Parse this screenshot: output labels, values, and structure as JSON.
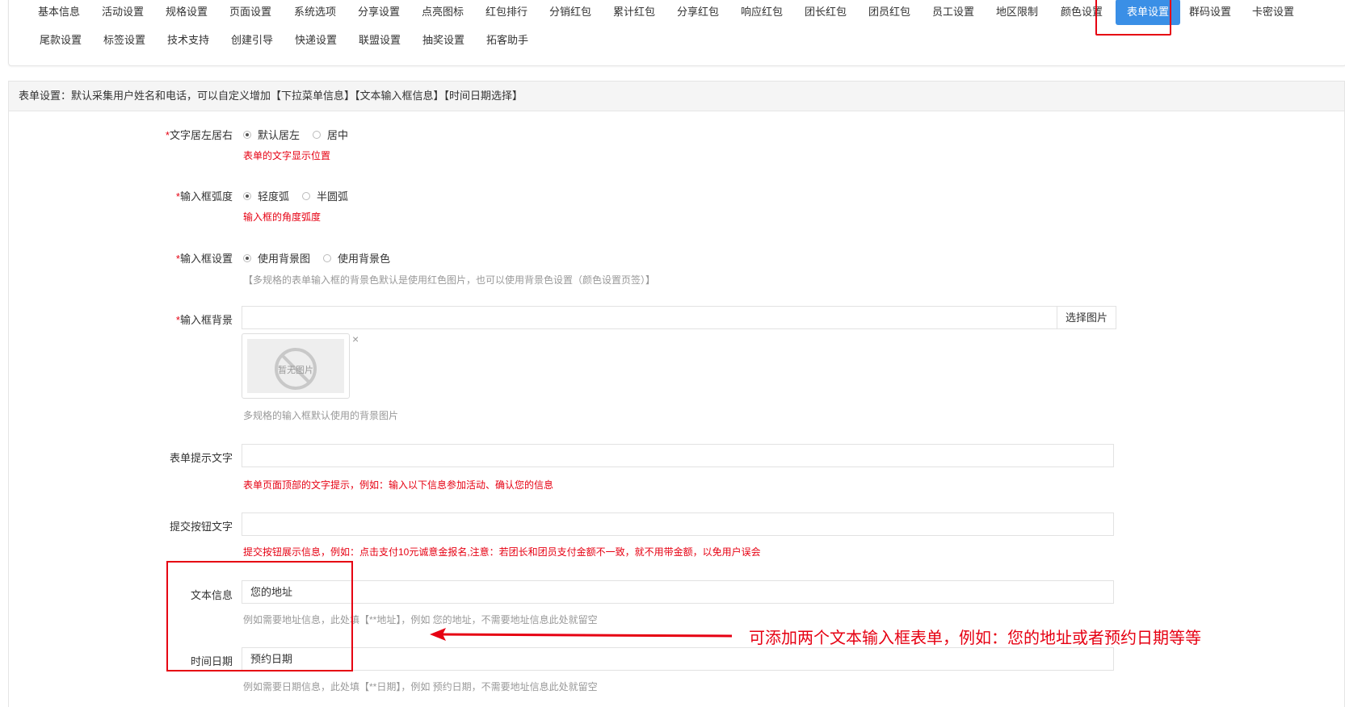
{
  "tabs_row1": [
    "基本信息",
    "活动设置",
    "规格设置",
    "页面设置",
    "系统选项",
    "分享设置",
    "点亮图标",
    "红包排行",
    "分销红包",
    "累计红包",
    "分享红包",
    "响应红包",
    "团长红包",
    "团员红包",
    "员工设置",
    "地区限制",
    "颜色设置",
    "表单设置",
    "群码设置",
    "卡密设置"
  ],
  "tabs_row2": [
    "尾款设置",
    "标签设置",
    "技术支持",
    "创建引导",
    "快递设置",
    "联盟设置",
    "抽奖设置",
    "拓客助手"
  ],
  "section_header": "表单设置：默认采集用户姓名和电话，可以自定义增加【下拉菜单信息】【文本输入框信息】【时间日期选择】",
  "required_mark": "*",
  "text_align": {
    "label": "文字居左居右",
    "options": [
      "默认居左",
      "居中"
    ],
    "hint": "表单的文字显示位置"
  },
  "input_radius": {
    "label": "输入框弧度",
    "options": [
      "轻度弧",
      "半圆弧"
    ],
    "hint": "输入框的角度弧度"
  },
  "input_setting": {
    "label": "输入框设置",
    "options": [
      "使用背景图",
      "使用背景色"
    ],
    "hint": "【多规格的表单输入框的背景色默认是使用红色图片，也可以使用背景色设置（颜色设置页签）】"
  },
  "input_bg": {
    "label": "输入框背景",
    "button": "选择图片",
    "placeholder_img_text": "暂无图片",
    "close": "×",
    "hint": "多规格的输入框默认使用的背景图片"
  },
  "form_tip": {
    "label": "表单提示文字",
    "hint": "表单页面顶部的文字提示，例如：输入以下信息参加活动、确认您的信息"
  },
  "submit_text": {
    "label": "提交按钮文字",
    "hint": "提交按钮展示信息，例如：点击支付10元诚意金报名,注意：若团长和团员支付金额不一致，就不用带金额，以免用户误会"
  },
  "text_info": {
    "label": "文本信息",
    "value": "您的地址",
    "hint": "例如需要地址信息，此处填【**地址】，例如 您的地址，不需要地址信息此处就留空"
  },
  "date_info": {
    "label": "时间日期",
    "value": "预约日期",
    "hint": "例如需要日期信息，此处填【**日期】，例如 预约日期，不需要地址信息此处就留空"
  },
  "annotation": "可添加两个文本输入框表单，例如：您的地址或者预约日期等等",
  "colors": {
    "accent": "#3a8fe6",
    "red": "#e60012"
  }
}
